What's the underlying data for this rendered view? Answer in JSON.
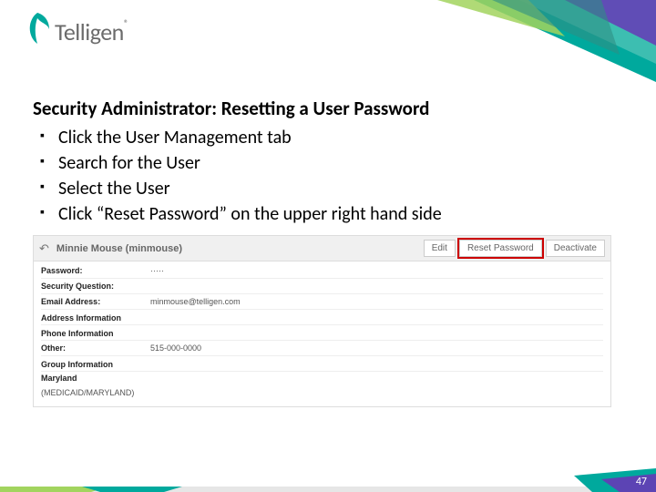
{
  "logo": {
    "text": "Telligen",
    "trademark": "®"
  },
  "slide": {
    "title": "Security Administrator:  Resetting a User Password",
    "bullets": [
      "Click the User Management tab",
      "Search for the User",
      "Select the User",
      "Click “Reset Password” on the upper right hand side"
    ]
  },
  "screenshot": {
    "back_icon": "↶",
    "user_display": "Minnie Mouse (minmouse)",
    "buttons": {
      "edit": "Edit",
      "reset": "Reset Password",
      "deactivate": "Deactivate"
    },
    "fields": {
      "password_label": "Password:",
      "password_value": "·····",
      "secq_label": "Security Question:",
      "secq_value": "",
      "email_label": "Email Address:",
      "email_value": "minmouse@telligen.com",
      "address_header": "Address Information",
      "phone_header": "Phone Information",
      "other_label": "Other:",
      "other_value": "515-000-0000",
      "group_header": "Group Information",
      "group_name": "Maryland",
      "group_detail": "(MEDICAID/MARYLAND)"
    }
  },
  "page_number": "47"
}
